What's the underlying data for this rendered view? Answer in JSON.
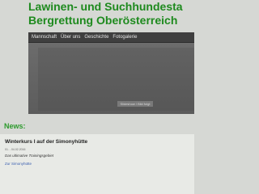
{
  "header": {
    "title_line1": "Lawinen- und Suchhundesta",
    "title_line2": "Bergrettung Oberösterreich"
  },
  "nav": {
    "items": [
      {
        "label": "Mannschaft"
      },
      {
        "label": "Über uns"
      },
      {
        "label": "Geschichte"
      },
      {
        "label": "Fotogalerie"
      }
    ]
  },
  "hero": {
    "placeholder_label": "Slideshow / Bild folgt"
  },
  "news": {
    "heading": "News:",
    "article": {
      "title": "Winterkurs I auf der Simonyhütte",
      "date": "01. - 04.02.2016",
      "description": "Das ultimative Trainingsgebiet",
      "link_label": "Zur Simonyhütte"
    }
  },
  "colors": {
    "title_green": "#1e8a1e",
    "nav_bg": "#3f3f3f",
    "hero_bg": "#5c5c5c",
    "page_bg": "#d6d8d4",
    "link_blue": "#3a5fb0"
  }
}
